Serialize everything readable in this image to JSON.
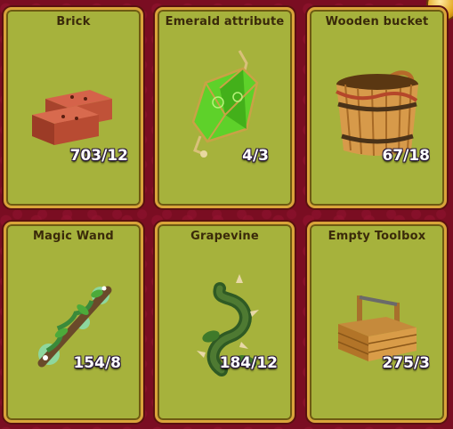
{
  "items": [
    {
      "name": "Brick",
      "count": "703/12",
      "icon": "brick-icon"
    },
    {
      "name": "Emerald attribute",
      "count": "4/3",
      "icon": "emerald-lantern-icon"
    },
    {
      "name": "Wooden bucket",
      "count": "67/18",
      "icon": "wooden-bucket-icon"
    },
    {
      "name": "Magic Wand",
      "count": "154/8",
      "icon": "magic-wand-icon"
    },
    {
      "name": "Grapevine",
      "count": "184/12",
      "icon": "grapevine-icon"
    },
    {
      "name": "Empty Toolbox",
      "count": "275/3",
      "icon": "toolbox-icon"
    }
  ],
  "colors": {
    "background": "#7a0d22",
    "card": "#a6b23c",
    "card_border": "#d9a43a"
  }
}
